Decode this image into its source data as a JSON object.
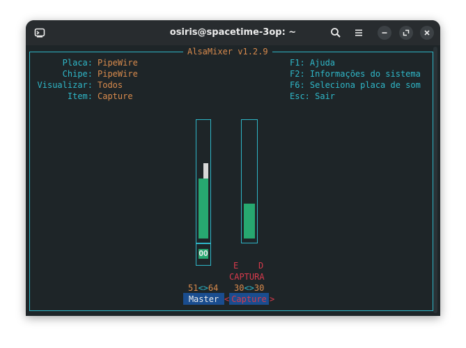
{
  "window": {
    "title": "osiris@spacetime-3op: ~"
  },
  "titlebar": {
    "icons": [
      "terminal-icon",
      "search-icon",
      "menu-icon",
      "minimize-icon",
      "maximize-icon",
      "close-icon"
    ]
  },
  "mixer": {
    "title": "AlsaMixer v1.2.9",
    "info": [
      {
        "label": "Placa:",
        "value": "PipeWire"
      },
      {
        "label": "Chipe:",
        "value": "PipeWire"
      },
      {
        "label": "Visualizar:",
        "value": "Todos"
      },
      {
        "label": "Item:",
        "value": "Capture"
      }
    ],
    "help": [
      "F1: Ajuda",
      "F2: Informações do sistema",
      "F6: Seleciona placa de som",
      "Esc: Sair"
    ],
    "controls": [
      {
        "name": "Master",
        "level_percent": 51,
        "peak_percent": 64,
        "left": "51",
        "sep": "<>",
        "right": "64",
        "mute": "OO",
        "selected": false
      },
      {
        "name": "Capture",
        "level_percent": 30,
        "left": "30",
        "sep": "<>",
        "right": "30",
        "channel_left": "E",
        "channel_right": "D",
        "capture_label": "CAPTURA",
        "selected": true,
        "arrow_left": "<",
        "arrow_right": ">"
      }
    ]
  },
  "colors": {
    "background": "#1e2528",
    "titlebar": "#282c2f",
    "cyan": "#2fb8c9",
    "orange": "#d98b4d",
    "green": "#27a870",
    "red": "#d83a4c",
    "selection": "#1a4d8f"
  }
}
